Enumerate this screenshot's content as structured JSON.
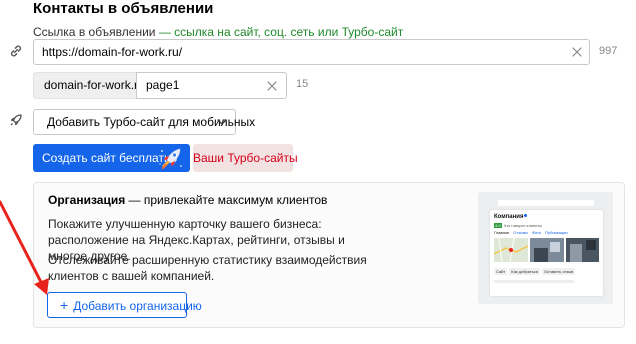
{
  "section": {
    "title": "Контакты в объявлении"
  },
  "link_field": {
    "label": "Ссылка в объявлении",
    "hint": "— ссылка на сайт, соц. сеть или Турбо-сайт",
    "value": "https://domain-for-work.ru/",
    "counter": "997"
  },
  "path_field": {
    "prefix": "domain-for-work.ru/",
    "value": "page1",
    "counter": "15"
  },
  "turbo": {
    "select_label": "Добавить Турбо-сайт для мобильных",
    "create_button": "Создать сайт бесплатно",
    "my_sites_button": "Ваши Турбо-сайты"
  },
  "organization": {
    "title_bold": "Организация",
    "title_rest": " — привлекайте максимум клиентов",
    "paragraph1": "Покажите улучшенную карточку вашего бизнеса: расположение на Яндекс.Картах, рейтинги, отзывы и многое другое.",
    "paragraph2": "Отслеживайте расширенную статистику взаимодействия клиентов с вашей компанией.",
    "add_button": "Добавить организацию",
    "preview": {
      "company": "Компания",
      "rating_score": "4.9",
      "rating_text": "Что говорят клиенты",
      "tabs": [
        "Главное",
        "Отзывы",
        "Фото",
        "Публикации"
      ],
      "buttons": [
        "Сайт",
        "Как добраться",
        "Оставить отзыв"
      ]
    }
  },
  "colors": {
    "accent": "#1565ea",
    "hint_green": "#1f8a2b",
    "danger_red": "#d4001b",
    "annotation_arrow": "#e8231b"
  },
  "icons": {
    "link": "link-icon",
    "rocket": "rocket-icon",
    "clear": "close-icon",
    "chevron": "chevron-down-icon",
    "plus": "plus-icon"
  }
}
